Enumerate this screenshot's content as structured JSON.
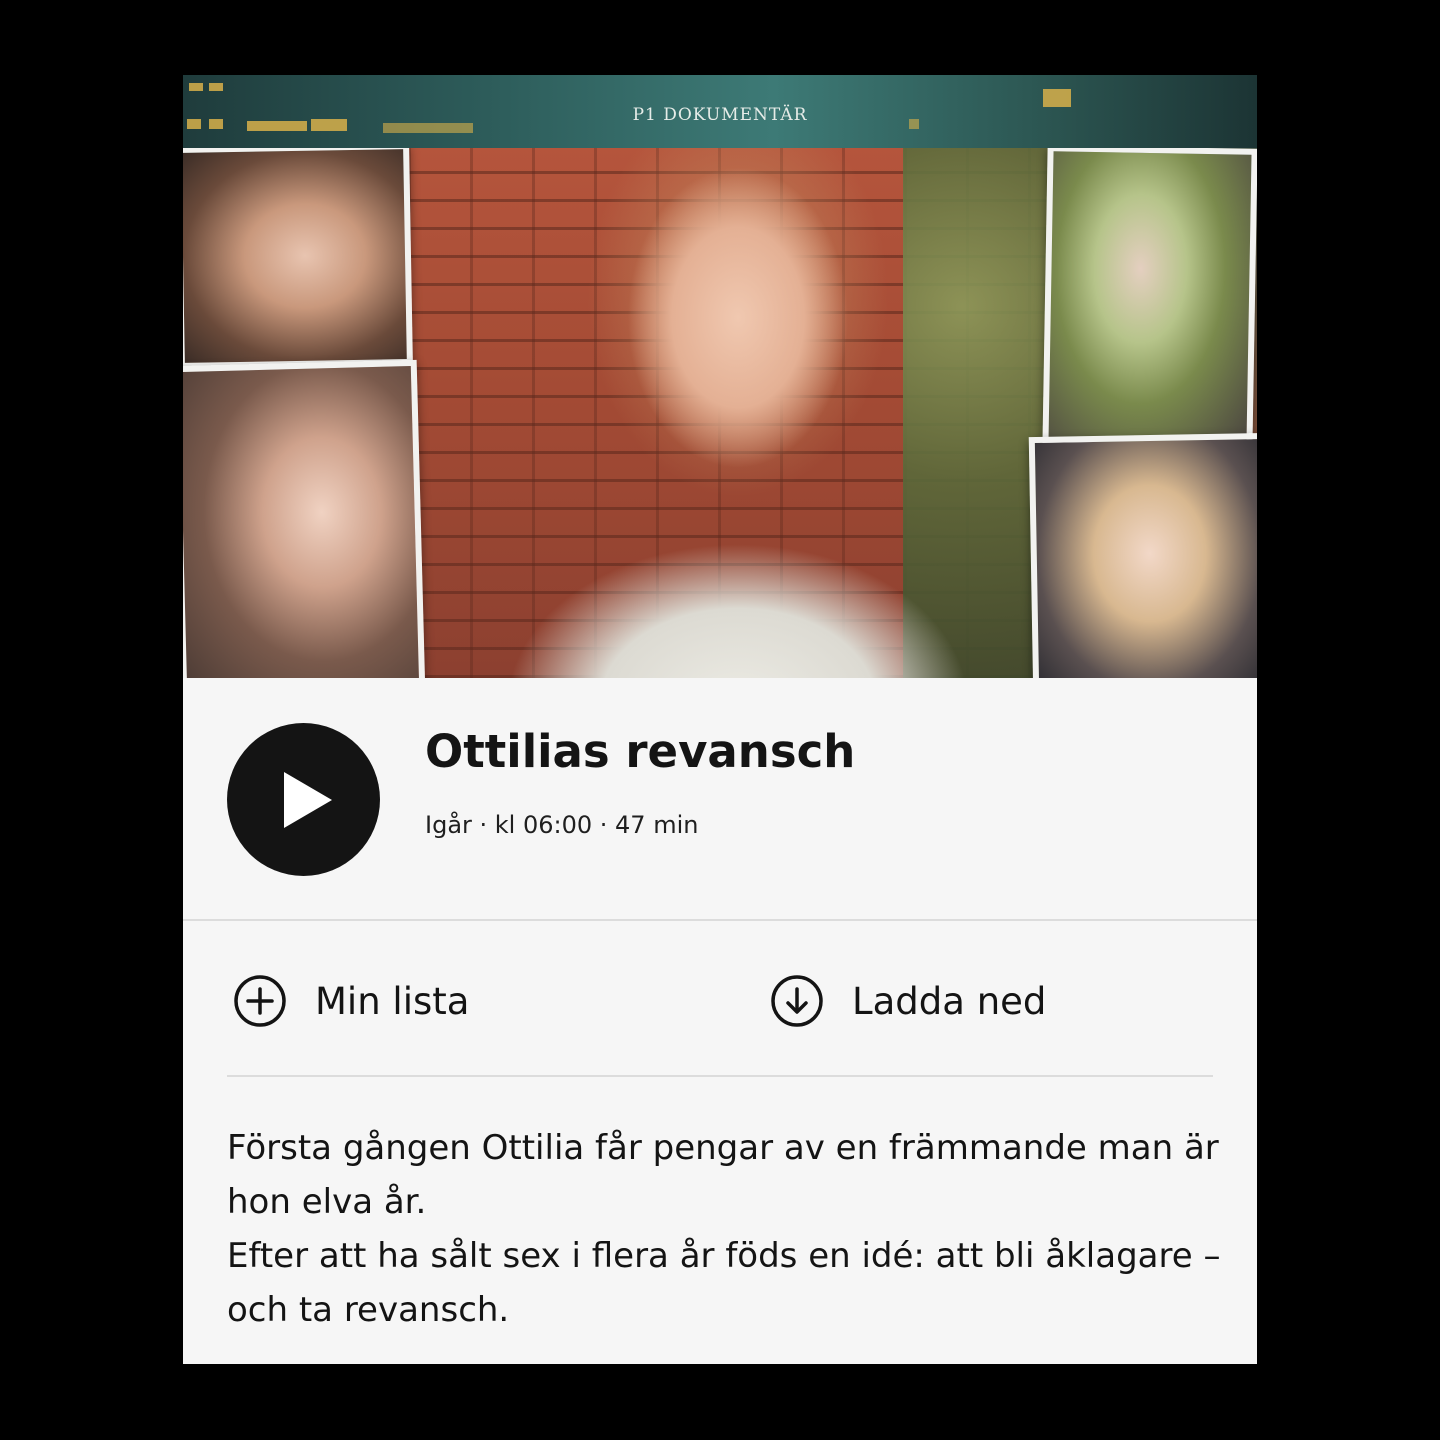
{
  "hero": {
    "label": "P1 DOKUMENTÄR"
  },
  "episode": {
    "title": "Ottilias revansch",
    "meta": "Igår · kl 06:00 · 47 min"
  },
  "actions": {
    "my_list_label": "Min lista",
    "download_label": "Ladda ned"
  },
  "description": {
    "paragraph_1": "Första gången Ottilia får pengar av en främmande man är hon elva år.",
    "paragraph_2": "Efter att ha sålt sex i flera år föds en idé: att bli åklagare – och ta revansch."
  },
  "icons": {
    "play": "play-icon",
    "add": "plus-circle-icon",
    "download": "download-circle-icon"
  },
  "colors": {
    "background": "#000000",
    "card": "#f6f6f6",
    "text": "#141414",
    "play_button": "#141414",
    "divider": "#dcdcdc"
  }
}
